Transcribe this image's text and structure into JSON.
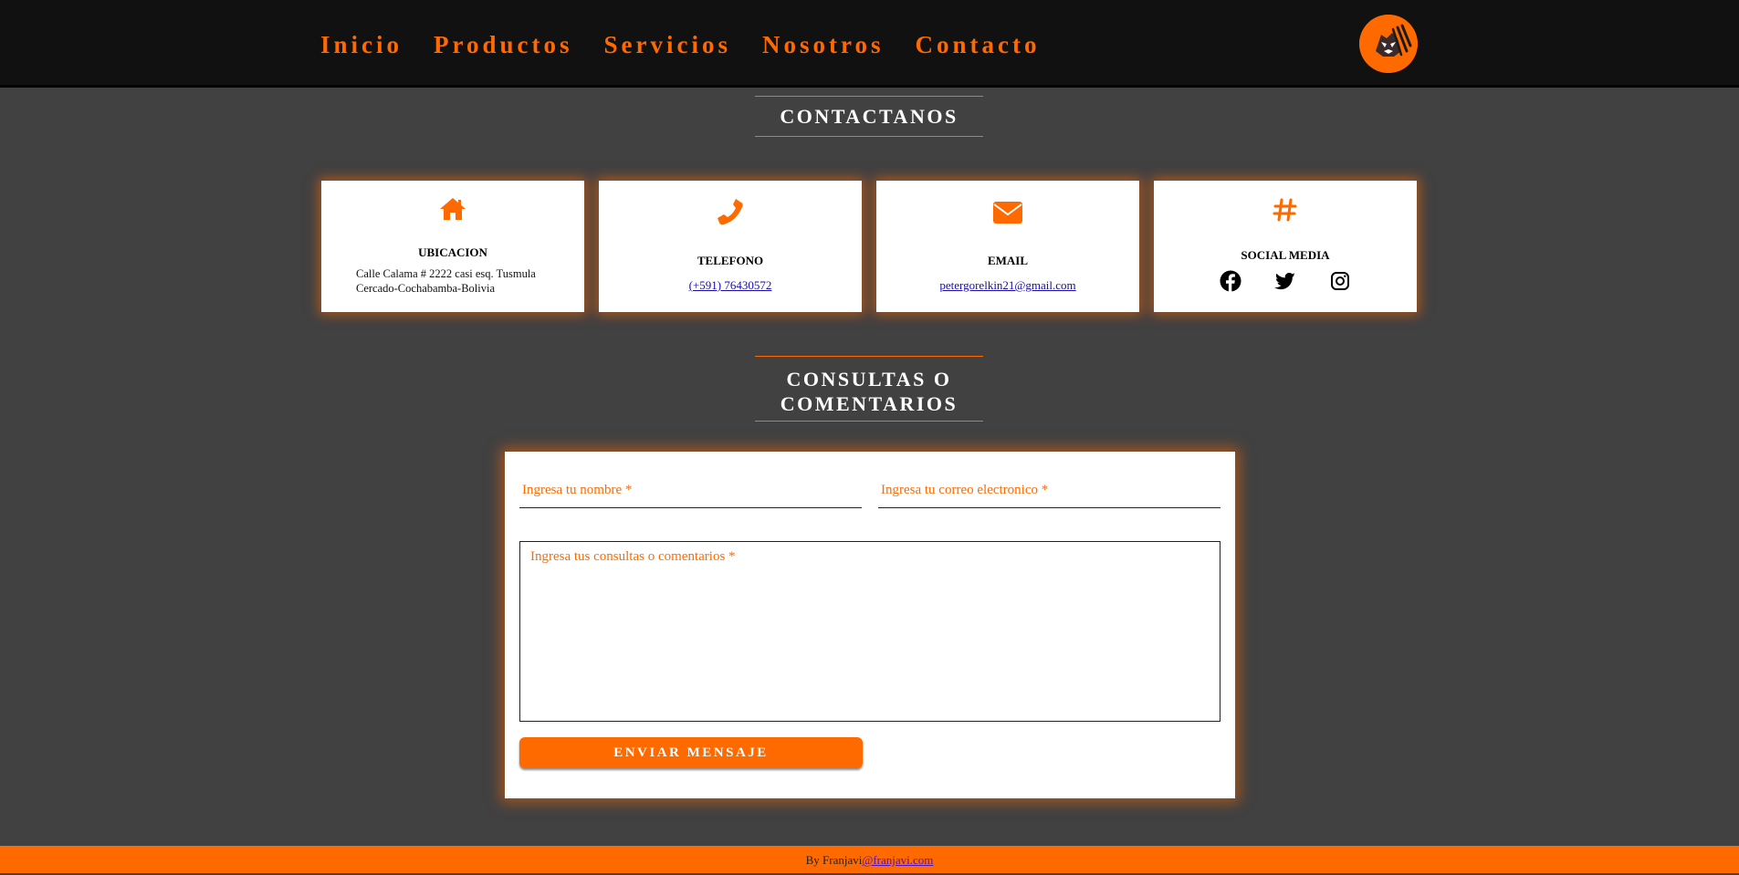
{
  "nav": {
    "items": [
      "Inicio",
      "Productos",
      "Servicios",
      "Nosotros",
      "Contacto"
    ],
    "logo_icon": "tiger-logo-icon",
    "accent": "#ff6a00"
  },
  "contact": {
    "title": "CONTACTANOS",
    "cards": [
      {
        "icon": "home-icon",
        "title": "UBICACION",
        "text1": "Calle Calama # 2222 casi esq. Tusmula",
        "text2": "Cercado-Cochabamba-Bolivia"
      },
      {
        "icon": "phone-icon",
        "title": "TELEFONO",
        "link": "(+591) 76430572"
      },
      {
        "icon": "envelope-icon",
        "title": "EMAIL",
        "link": "petergorelkin21@gmail.com"
      },
      {
        "icon": "hashtag-icon",
        "title": "SOCIAL MEDIA",
        "socials": [
          "facebook-icon",
          "twitter-icon",
          "instagram-icon"
        ]
      }
    ]
  },
  "consultas": {
    "title_line1": "CONSULTAS O",
    "title_line2": "COMENTARIOS",
    "name_placeholder": "Ingresa tu nombre *",
    "email_placeholder": "Ingresa tu correo electronico *",
    "message_placeholder": "Ingresa tus consultas o comentarios *",
    "send_label": "ENVIAR MENSAJE"
  },
  "footer": {
    "prefix": "By Franjavi",
    "link": "@franjavi.com"
  }
}
